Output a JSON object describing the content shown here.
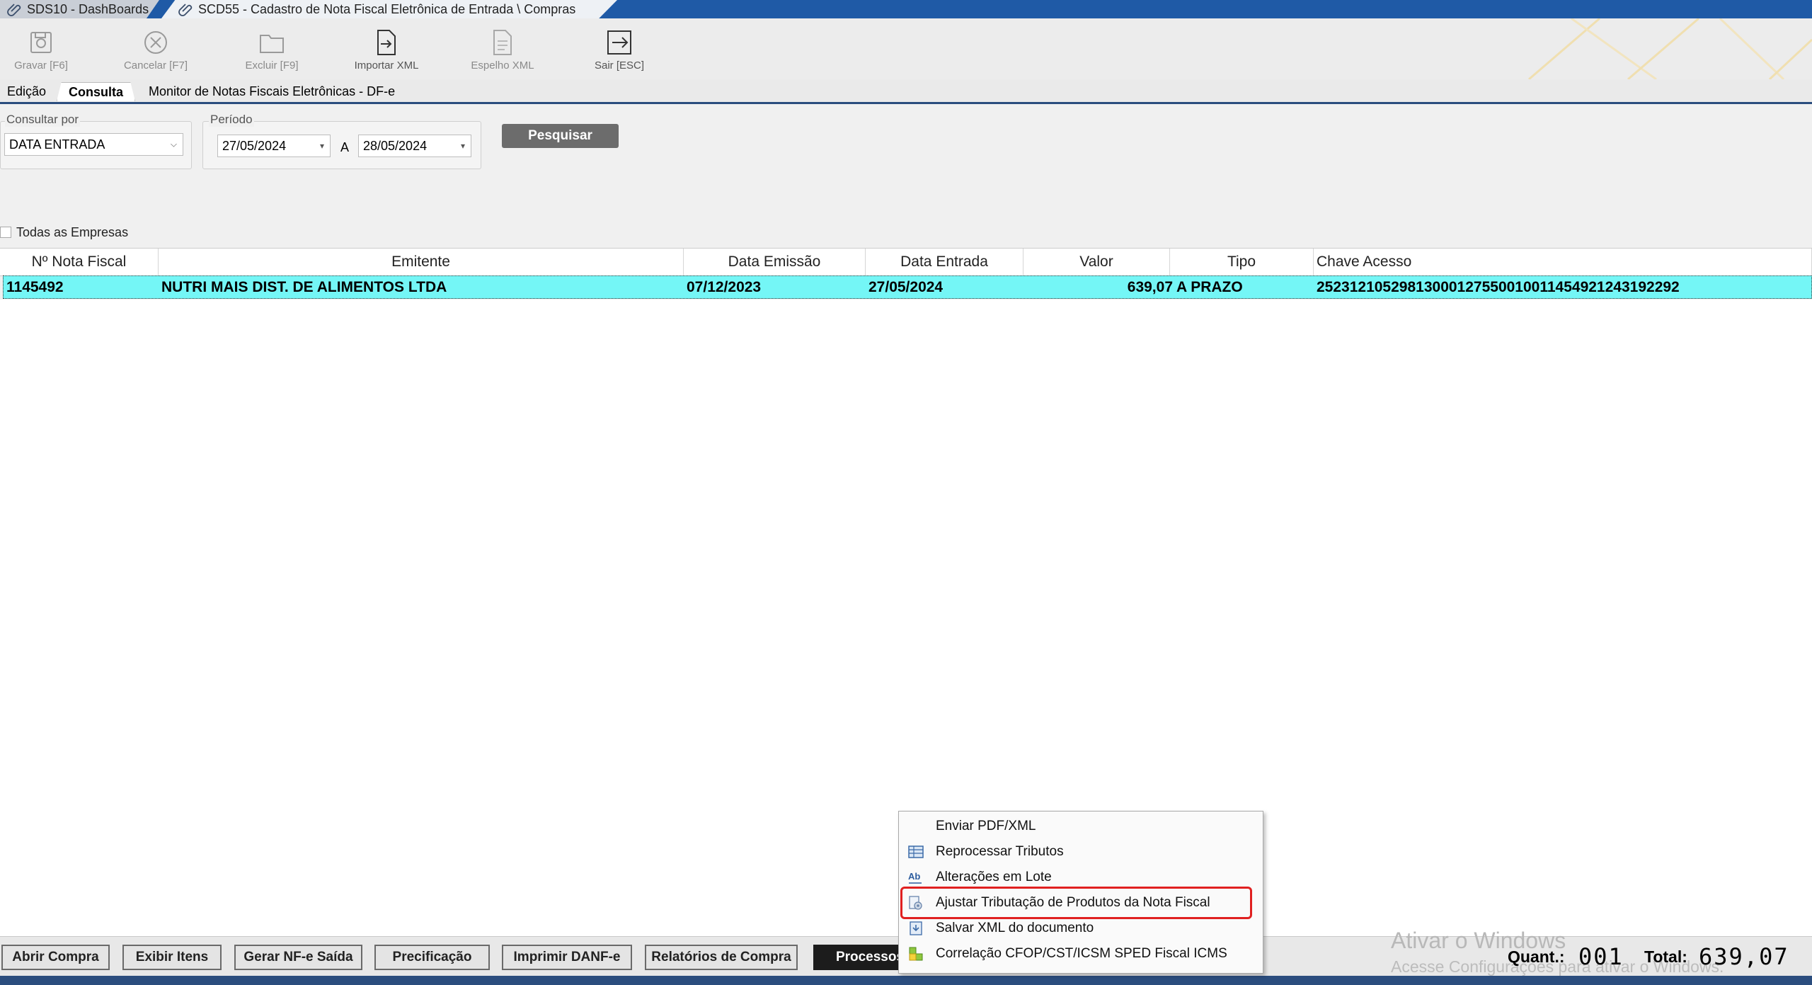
{
  "window_tabs": [
    {
      "label": "SDS10 - DashBoards"
    },
    {
      "label": "SCD55 - Cadastro de Nota Fiscal Eletrônica de Entrada \\ Compras"
    }
  ],
  "toolbar": {
    "gravar": "Gravar [F6]",
    "cancelar": "Cancelar [F7]",
    "excluir": "Excluir [F9]",
    "importar": "Importar XML",
    "espelho": "Espelho XML",
    "sair": "Sair [ESC]"
  },
  "subtabs": {
    "edicao": "Edição",
    "consulta": "Consulta",
    "monitor": "Monitor de Notas Fiscais Eletrônicas - DF-e"
  },
  "filters": {
    "consultar_por_label": "Consultar por",
    "consultar_por_value": "DATA ENTRADA",
    "periodo_label": "Período",
    "date_from": "27/05/2024",
    "a_label": "A",
    "date_to": "28/05/2024",
    "pesquisar": "Pesquisar",
    "todas_empresas": "Todas as Empresas"
  },
  "grid": {
    "columns": [
      "Nº Nota Fiscal",
      "Emitente",
      "Data Emissão",
      "Data Entrada",
      "Valor",
      "Tipo",
      "Chave Acesso"
    ],
    "rows": [
      {
        "nota": "1145492",
        "emitente": "NUTRI MAIS DIST. DE ALIMENTOS LTDA",
        "emissao": "07/12/2023",
        "entrada": "27/05/2024",
        "valor": "639,07",
        "tipo": "A PRAZO",
        "chave": "25231210529813000127550010011454921243192292"
      }
    ]
  },
  "bottom_buttons": {
    "abrir": "Abrir Compra",
    "exibir": "Exibir Itens",
    "gerar": "Gerar NF-e Saída",
    "precificacao": "Precificação",
    "imprimir": "Imprimir DANF-e",
    "relatorios": "Relatórios de Compra",
    "processos": "Processos"
  },
  "totals": {
    "quant_label": "Quant.:",
    "quant_value": "001",
    "total_label": "Total:",
    "total_value": "639,07"
  },
  "watermark": {
    "line1": "Ativar o Windows",
    "line2": "Acesse Configurações para ativar o Windows."
  },
  "context_menu": {
    "items": [
      {
        "label": "Enviar PDF/XML",
        "icon": "none"
      },
      {
        "label": "Reprocessar Tributos",
        "icon": "table-icon"
      },
      {
        "label": "Alterações em Lote",
        "icon": "abc-icon"
      },
      {
        "label": "Ajustar Tributação de Produtos da Nota Fiscal",
        "icon": "calculator-gear-icon"
      },
      {
        "label": "Salvar XML do documento",
        "icon": "save-down-icon"
      },
      {
        "label": "Correlação CFOP/CST/ICSM SPED Fiscal ICMS",
        "icon": "green-blocks-icon"
      }
    ],
    "highlighted_index": 3
  },
  "colors": {
    "title_bar": "#1f5aa6",
    "selected_row": "#74f6f6",
    "highlight_box": "#e02020"
  }
}
